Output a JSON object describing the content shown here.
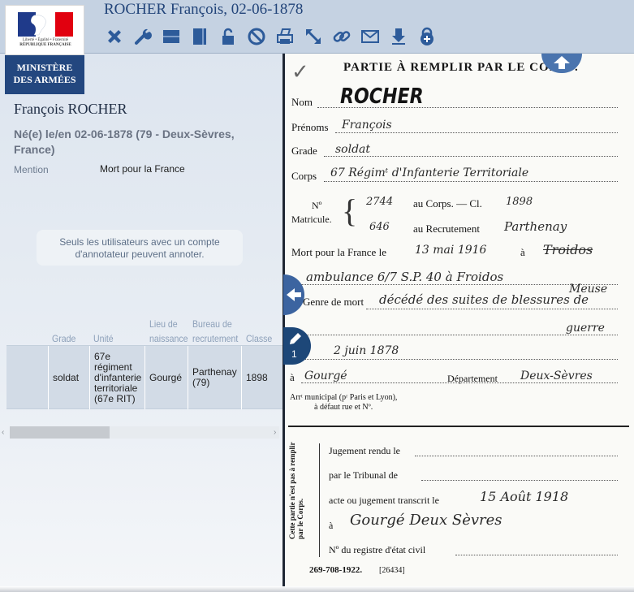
{
  "window": {
    "title": "ROCHER François, 02-06-1878"
  },
  "logo": {
    "motto_line1": "Liberté • Égalité • Fraternité",
    "motto_line2": "RÉPUBLIQUE FRANÇAISE",
    "ministry_line1": "MINISTÈRE",
    "ministry_line2": "DES ARMÉES"
  },
  "toolbar": {
    "icons": [
      "close-icon",
      "wrench-icon",
      "horizontal-layout-icon",
      "vertical-layout-icon",
      "lock-icon",
      "forbidden-icon",
      "print-icon",
      "resize-icon",
      "link-icon",
      "mail-icon",
      "download-icon",
      "lock-plus-icon"
    ],
    "accent": "#2d5b9a"
  },
  "person": {
    "name": "François ROCHER",
    "birth": "Né(e) le/en 02-06-1878 (79 - Deux-Sèvres, France)",
    "mention_label": "Mention",
    "mention_value": "Mort pour la France"
  },
  "annotation_notice": "Seuls les utilisateurs avec un compte d'annotateur peuvent annoter.",
  "table": {
    "headers": [
      "Grade",
      "Unité",
      "Lieu de naissance",
      "Bureau de recrutement",
      "Classe"
    ],
    "row": [
      "soldat",
      "67e régiment d'infanterie territoriale (67e RIT)",
      "Gourgé",
      "Parthenay (79)",
      "1898"
    ]
  },
  "edit_counter": "1",
  "document": {
    "heading": "PARTIE À REMPLIR PAR LE CORPS.",
    "nom_label": "Nom",
    "nom_value": "ROCHER",
    "prenoms_label": "Prénoms",
    "prenoms_value": "François",
    "grade_label": "Grade",
    "grade_value": "soldat",
    "corps_label": "Corps",
    "corps_value": "67 Régimᵗ d'Infanterie Territoriale",
    "no_label": "Nº",
    "matricule_label": "Matricule.",
    "au_corps_value": "2744",
    "au_corps_label": "au Corps. — Cl.",
    "classe_value": "1898",
    "recrutement_value": "646",
    "recrutement_label": "au Recrutement",
    "recrutement_place": "Parthenay",
    "mort_label": "Mort pour la France le",
    "mort_date": "13 mai 1916",
    "mort_a": "à",
    "mort_place": "Troidos",
    "ambulance": "ambulance 6/7 S.P. 40 à Froidos",
    "meuse": "Meuse",
    "genre_label": "Genre de mort",
    "genre_value": "décédé des suites de blessures de",
    "guerre": "guerre",
    "ne_date": "2 juin 1878",
    "ne_a": "à",
    "ne_place": "Gourgé",
    "departement_label": "Département",
    "departement_value": "Deux-Sèvres",
    "arr_label": "Arrᵗ municipal (pʳ Paris et Lyon),",
    "arr_label2": "à défaut rue et Nº.",
    "side_note": "Cette partie n'est pas à remplir par le Corps.",
    "jugement_label": "Jugement rendu le",
    "tribunal_label": "par le Tribunal de",
    "acte_label": "acte ou jugement transcrit le",
    "acte_date": "15 Août 1918",
    "acte_a": "à",
    "acte_place": "Gourgé Deux Sèvres",
    "registre_label": "Nº du registre d'état civil",
    "footer_code": "269-708-1922.",
    "footer_num": "[26434]"
  }
}
